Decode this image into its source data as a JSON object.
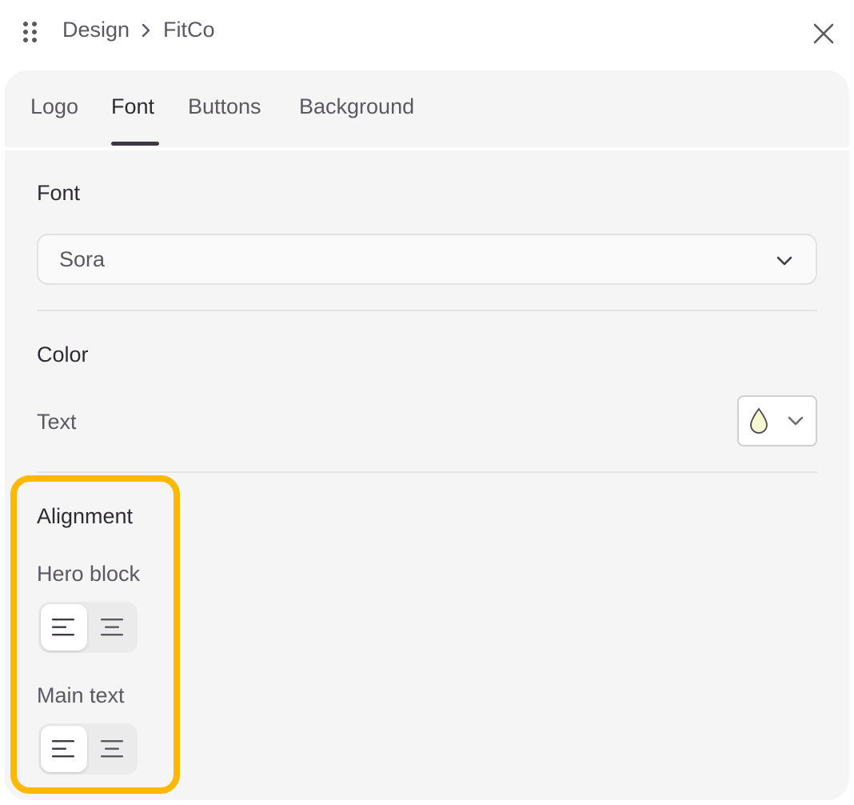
{
  "header": {
    "breadcrumb": [
      "Design",
      "FitCo"
    ],
    "drag_icon": "drag-handle-icon",
    "close_icon": "close-icon"
  },
  "tabs": [
    {
      "label": "Logo",
      "active": false
    },
    {
      "label": "Font",
      "active": true
    },
    {
      "label": "Buttons",
      "active": false
    },
    {
      "label": "Background",
      "active": false
    }
  ],
  "font_section": {
    "title": "Font",
    "select": {
      "value": "Sora",
      "icon": "chevron-down-icon"
    }
  },
  "color_section": {
    "title": "Color",
    "text_label": "Text",
    "text_color": "#f6f8d0",
    "icons": [
      "droplet-icon",
      "chevron-down-icon"
    ]
  },
  "alignment_section": {
    "title": "Alignment",
    "hero_block": {
      "label": "Hero block",
      "selected": "left"
    },
    "main_text": {
      "label": "Main text",
      "selected": "left"
    },
    "icons": [
      "align-left-icon",
      "align-center-icon"
    ]
  },
  "colors": {
    "highlight": "#ffb800",
    "panel_bg": "#f5f5f5",
    "text_primary": "#2f2b33",
    "text_secondary": "#5c5862"
  }
}
